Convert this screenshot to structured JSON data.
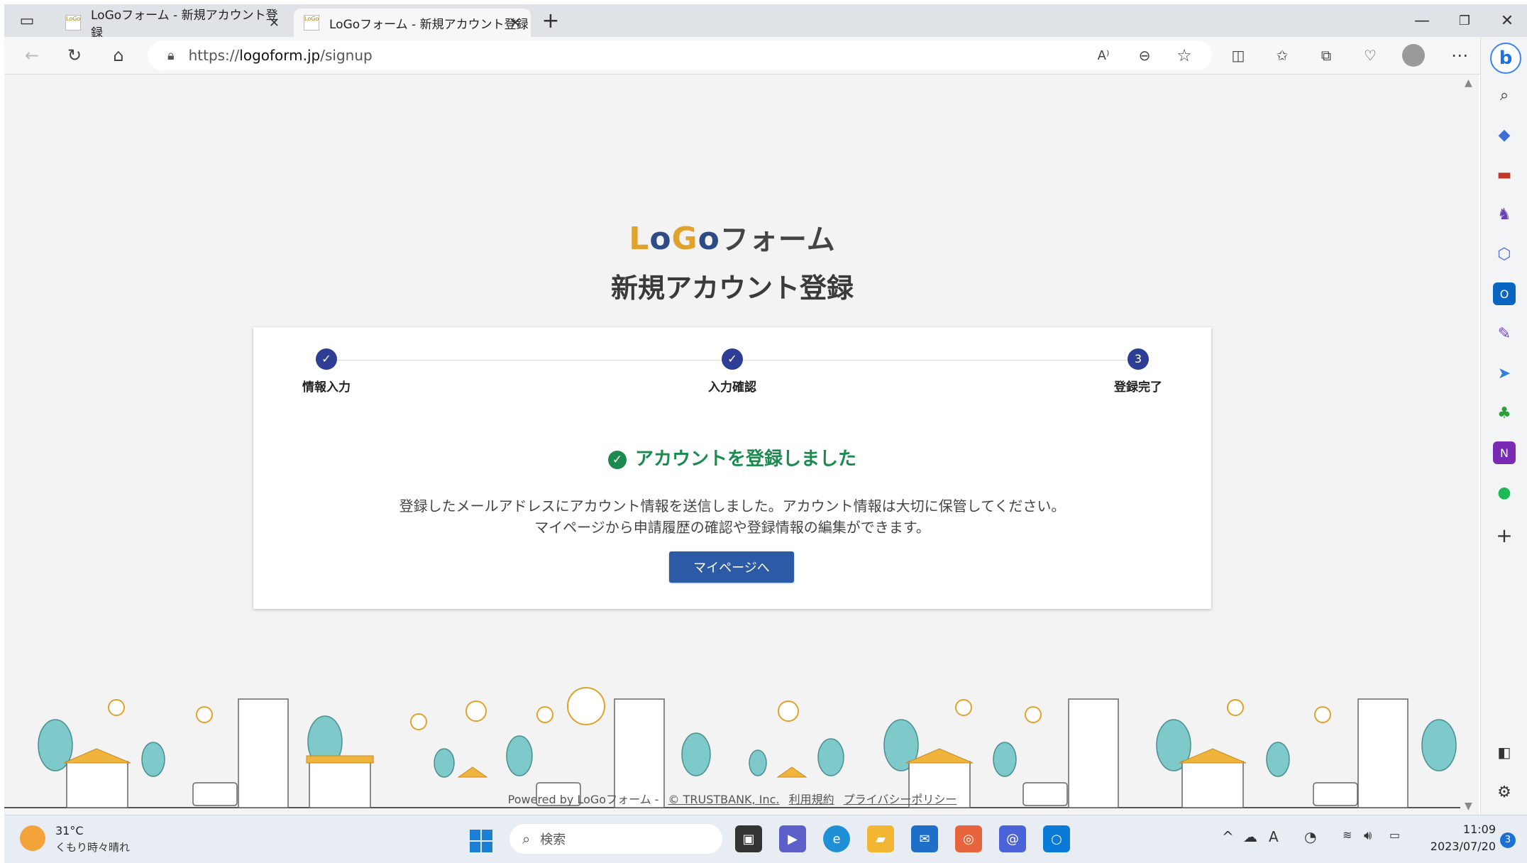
{
  "browser": {
    "tabs": [
      {
        "title": "LoGoフォーム - 新規アカウント登録",
        "active": false
      },
      {
        "title": "LoGoフォーム - 新規アカウント登録",
        "active": true
      }
    ],
    "url_prefix": "https://",
    "url_host": "logoform.jp",
    "url_path": "/signup"
  },
  "page": {
    "logo": {
      "l": "L",
      "o": "o",
      "g": "G",
      "o2": "o",
      "kana": "フォーム"
    },
    "title": "新規アカウント登録",
    "steps": [
      {
        "label": "情報入力",
        "state": "done",
        "marker": "✓"
      },
      {
        "label": "入力確認",
        "state": "done",
        "marker": "✓"
      },
      {
        "label": "登録完了",
        "state": "current",
        "marker": "3"
      }
    ],
    "success_heading": "アカウントを登録しました",
    "message_line1": "登録したメールアドレスにアカウント情報を送信しました。アカウント情報は大切に保管してください。",
    "message_line2": "マイページから申請履歴の確認や登録情報の編集ができます。",
    "mypage_button": "マイページへ",
    "footer": {
      "powered_by": "Powered by LoGoフォーム -",
      "company": "© TRUSTBANK, Inc.",
      "terms": "利用規約",
      "privacy": "プライバシーポリシー"
    }
  },
  "taskbar": {
    "weather_temp": "31°C",
    "weather_desc": "くもり時々晴れ",
    "search_placeholder": "検索",
    "time": "11:09",
    "date": "2023/07/20",
    "notifications": "3"
  },
  "colors": {
    "primary_button": "#2d5aa6",
    "step_active": "#2d3e94",
    "success_green": "#1b8a4f",
    "logo_orange": "#e0a22b",
    "logo_navy": "#2d4c86",
    "town_teal": "#7ec9c9",
    "town_orange": "#f0b43c"
  }
}
